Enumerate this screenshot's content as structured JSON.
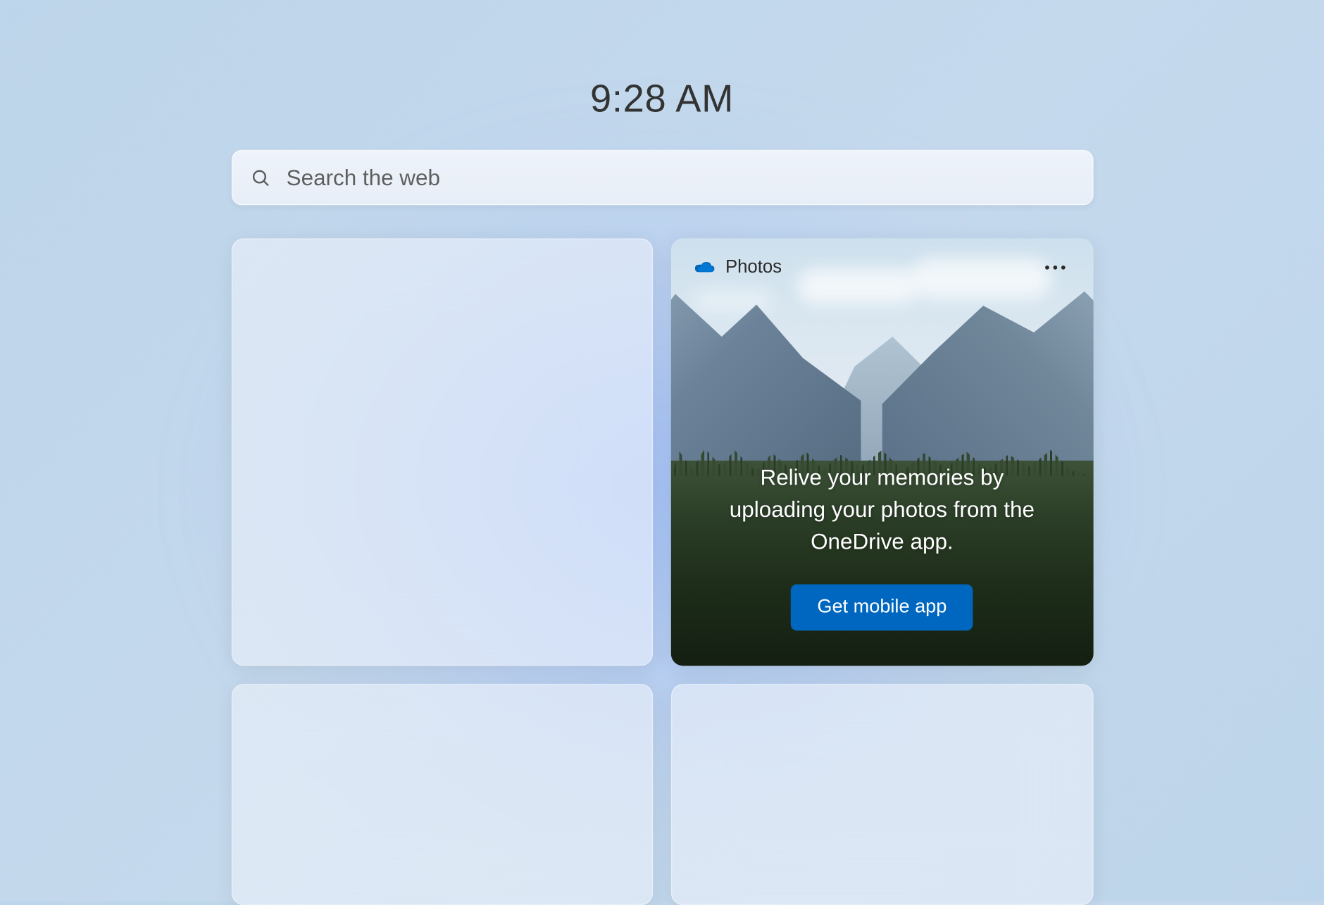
{
  "clock": {
    "time": "9:28 AM"
  },
  "search": {
    "placeholder": "Search the web"
  },
  "widgets": {
    "photos": {
      "title": "Photos",
      "message": "Relive your memories by uploading your photos from the OneDrive app.",
      "cta_label": "Get mobile app"
    }
  }
}
